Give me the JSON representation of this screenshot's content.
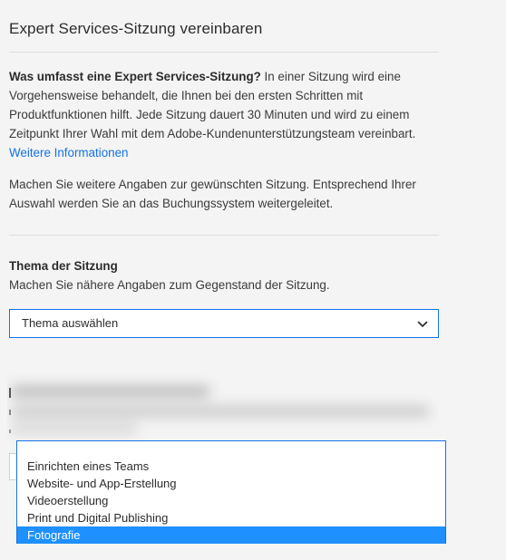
{
  "dialog": {
    "title": "Expert Services-Sitzung vereinbaren"
  },
  "intro": {
    "lead_bold": "Was umfasst eine Expert Services-Sitzung?",
    "text": " In einer Sitzung wird eine Vorgehensweise behandelt, die Ihnen bei den ersten Schritten mit Produktfunktionen hilft. Jede Sitzung dauert 30 Minuten und wird zu einem Zeitpunkt Ihrer Wahl mit dem Adobe-Kundenunterstützungsteam vereinbart.",
    "link_label": "Weitere Informationen"
  },
  "more_info": {
    "text": "Machen Sie weitere Angaben zur gewünschten Sitzung. Entsprechend Ihrer Auswahl werden Sie an das Buchungssystem weitergeleitet."
  },
  "topic": {
    "label": "Thema der Sitzung",
    "help": "Machen Sie nähere Angaben zum Gegenstand der Sitzung.",
    "selected": "Thema auswählen",
    "options": [
      "Einrichten eines Teams",
      "Website- und App-Erstellung",
      "Videoerstellung",
      "Print und Digital Publishing",
      "Fotografie"
    ],
    "highlighted_index": 4
  },
  "colors": {
    "accent": "#1473e6",
    "highlight": "#1e90ff",
    "background": "#f4f4f4"
  },
  "icons": {
    "select_arrow": "chevron-down-icon"
  }
}
